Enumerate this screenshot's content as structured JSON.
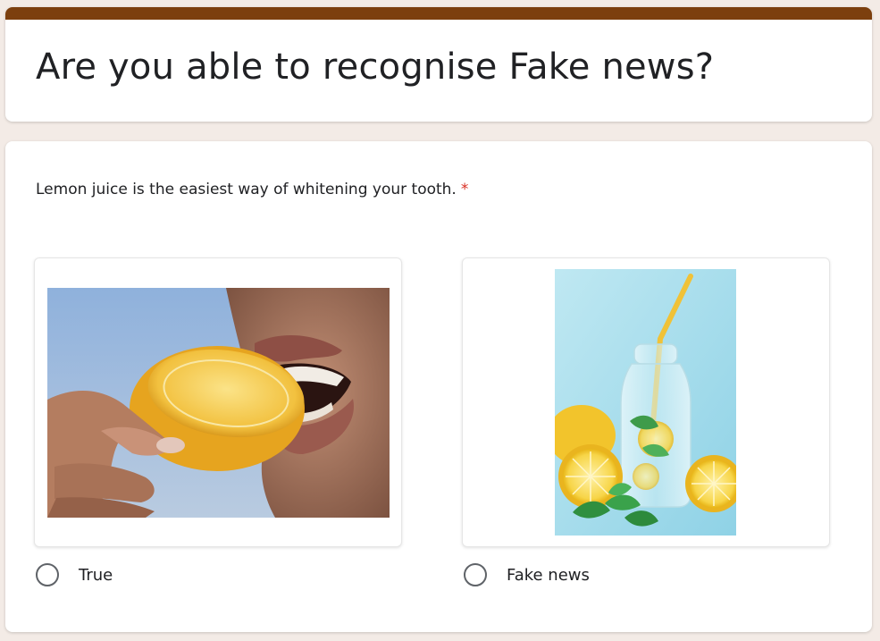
{
  "form": {
    "title": "Are you able to recognise Fake news?",
    "accent_color": "#7c3f0e",
    "background_color": "#f3ebe6"
  },
  "question": {
    "text": "Lemon juice is the easiest way of whitening your tooth.",
    "required_marker": "*",
    "options": [
      {
        "label": "True",
        "image": "woman-biting-lemon-photo"
      },
      {
        "label": "Fake news",
        "image": "lemon-water-bottle-with-straw-photo"
      }
    ]
  }
}
